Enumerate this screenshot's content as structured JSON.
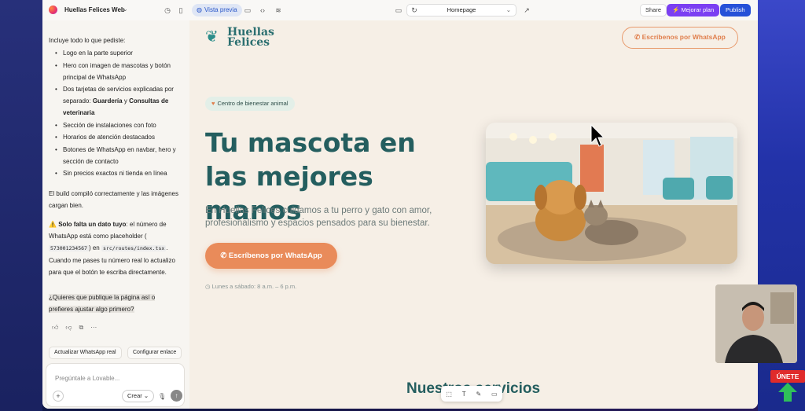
{
  "topbar": {
    "project_name": "Huellas Felices Web",
    "preview_label": "Vista previa",
    "route": "Homepage",
    "share_label": "Share",
    "upgrade_label": "Mejorar plan",
    "publish_label": "Publish"
  },
  "chat": {
    "intro": "Incluye todo lo que pediste:",
    "items": [
      "Logo en la parte superior",
      "Hero con imagen de mascotas y botón principal de WhatsApp",
      "Dos tarjetas de servicios explicadas por separado: Guardería y Consultas de veterinaria",
      "Sección de instalaciones con foto",
      "Horarios de atención destacados",
      "Botones de WhatsApp en navbar, hero y sección de contacto",
      "Sin precios exactos ni tienda en línea"
    ],
    "build_msg": "El build compiló correctamente y las imágenes cargan bien.",
    "warning_bold": "Solo falta un dato tuyo",
    "warning_text_1": ": el número de WhatsApp está como placeholder (",
    "phone_placeholder": "573001234567",
    "warning_text_2": ") en",
    "file_path": "src/routes/index.tsx",
    "warning_text_3": ". Cuando me pases tu número real lo actualizo para que el botón te escriba directamente.",
    "question": "¿Quieres que publique la página así o prefieres ajustar algo primero?",
    "chips": [
      "Actualizar WhatsApp real",
      "Configurar enlace"
    ],
    "input_placeholder": "Pregúntale a Lovable...",
    "crear_label": "Crear"
  },
  "site": {
    "logo_line1": "Huellas",
    "logo_line2": "Felices",
    "nav_cta": "Escríbenos por WhatsApp",
    "badge": "Centro de bienestar animal",
    "hero_title": "Tu mascota en las mejores manos",
    "hero_subtitle": "En Huellas Felices cuidamos a tu perro y gato con amor, profesionalismo y espacios pensados para su bienestar.",
    "hero_cta": "Escríbenos por WhatsApp",
    "hours": "Lunes a sábado: 8 a.m. – 6 p.m.",
    "services_title": "Nuestros servicios"
  },
  "overlay": {
    "join_label": "ÚNETE"
  },
  "colors": {
    "brand_teal": "#245e5f",
    "accent_orange": "#e98b5a",
    "publish_blue": "#2651d8",
    "upgrade_purple": "#7b3ff2"
  }
}
